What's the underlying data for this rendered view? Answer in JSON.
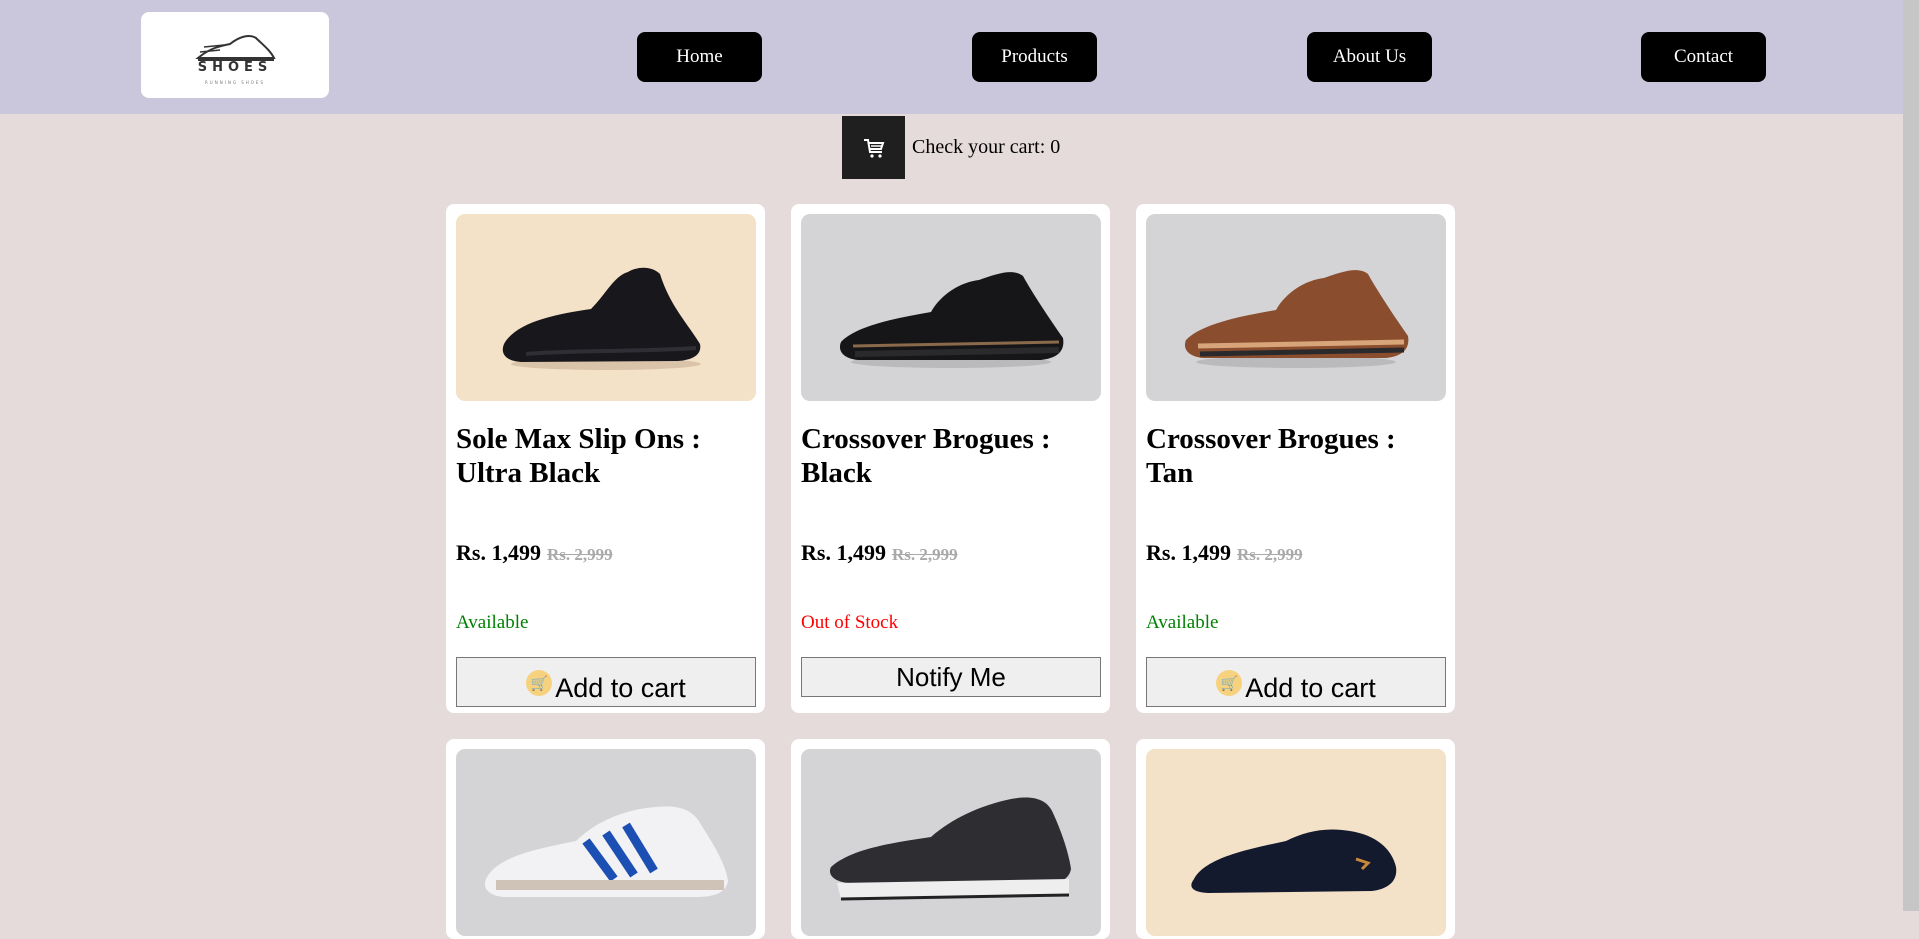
{
  "header": {
    "logo": {
      "brand": "SHOES",
      "tagline": "RUNNING SHOES"
    },
    "nav": [
      "Home",
      "Products",
      "About Us",
      "Contact"
    ]
  },
  "cart": {
    "label": "Check your cart: 0",
    "icon": "cart-icon"
  },
  "colors": {
    "header_bg": "#cac7dd",
    "page_bg": "#e6dbdb",
    "available": "#008000",
    "out_of_stock": "#ff0000"
  },
  "products": [
    {
      "name": "Sole Max Slip Ons : Ultra Black",
      "price": "Rs. 1,499",
      "old_price": "Rs. 2,999",
      "availability": "Available",
      "button": "Add to cart"
    },
    {
      "name": "Crossover Brogues : Black",
      "price": "Rs. 1,499",
      "old_price": "Rs. 2,999",
      "availability": "Out of Stock",
      "button": "Notify Me"
    },
    {
      "name": "Crossover Brogues : Tan",
      "price": "Rs. 1,499",
      "old_price": "Rs. 2,999",
      "availability": "Available",
      "button": "Add to cart"
    },
    {
      "name": "",
      "price": "",
      "old_price": "",
      "availability": "",
      "button": ""
    },
    {
      "name": "",
      "price": "",
      "old_price": "",
      "availability": "",
      "button": ""
    },
    {
      "name": "",
      "price": "",
      "old_price": "",
      "availability": "",
      "button": ""
    }
  ]
}
